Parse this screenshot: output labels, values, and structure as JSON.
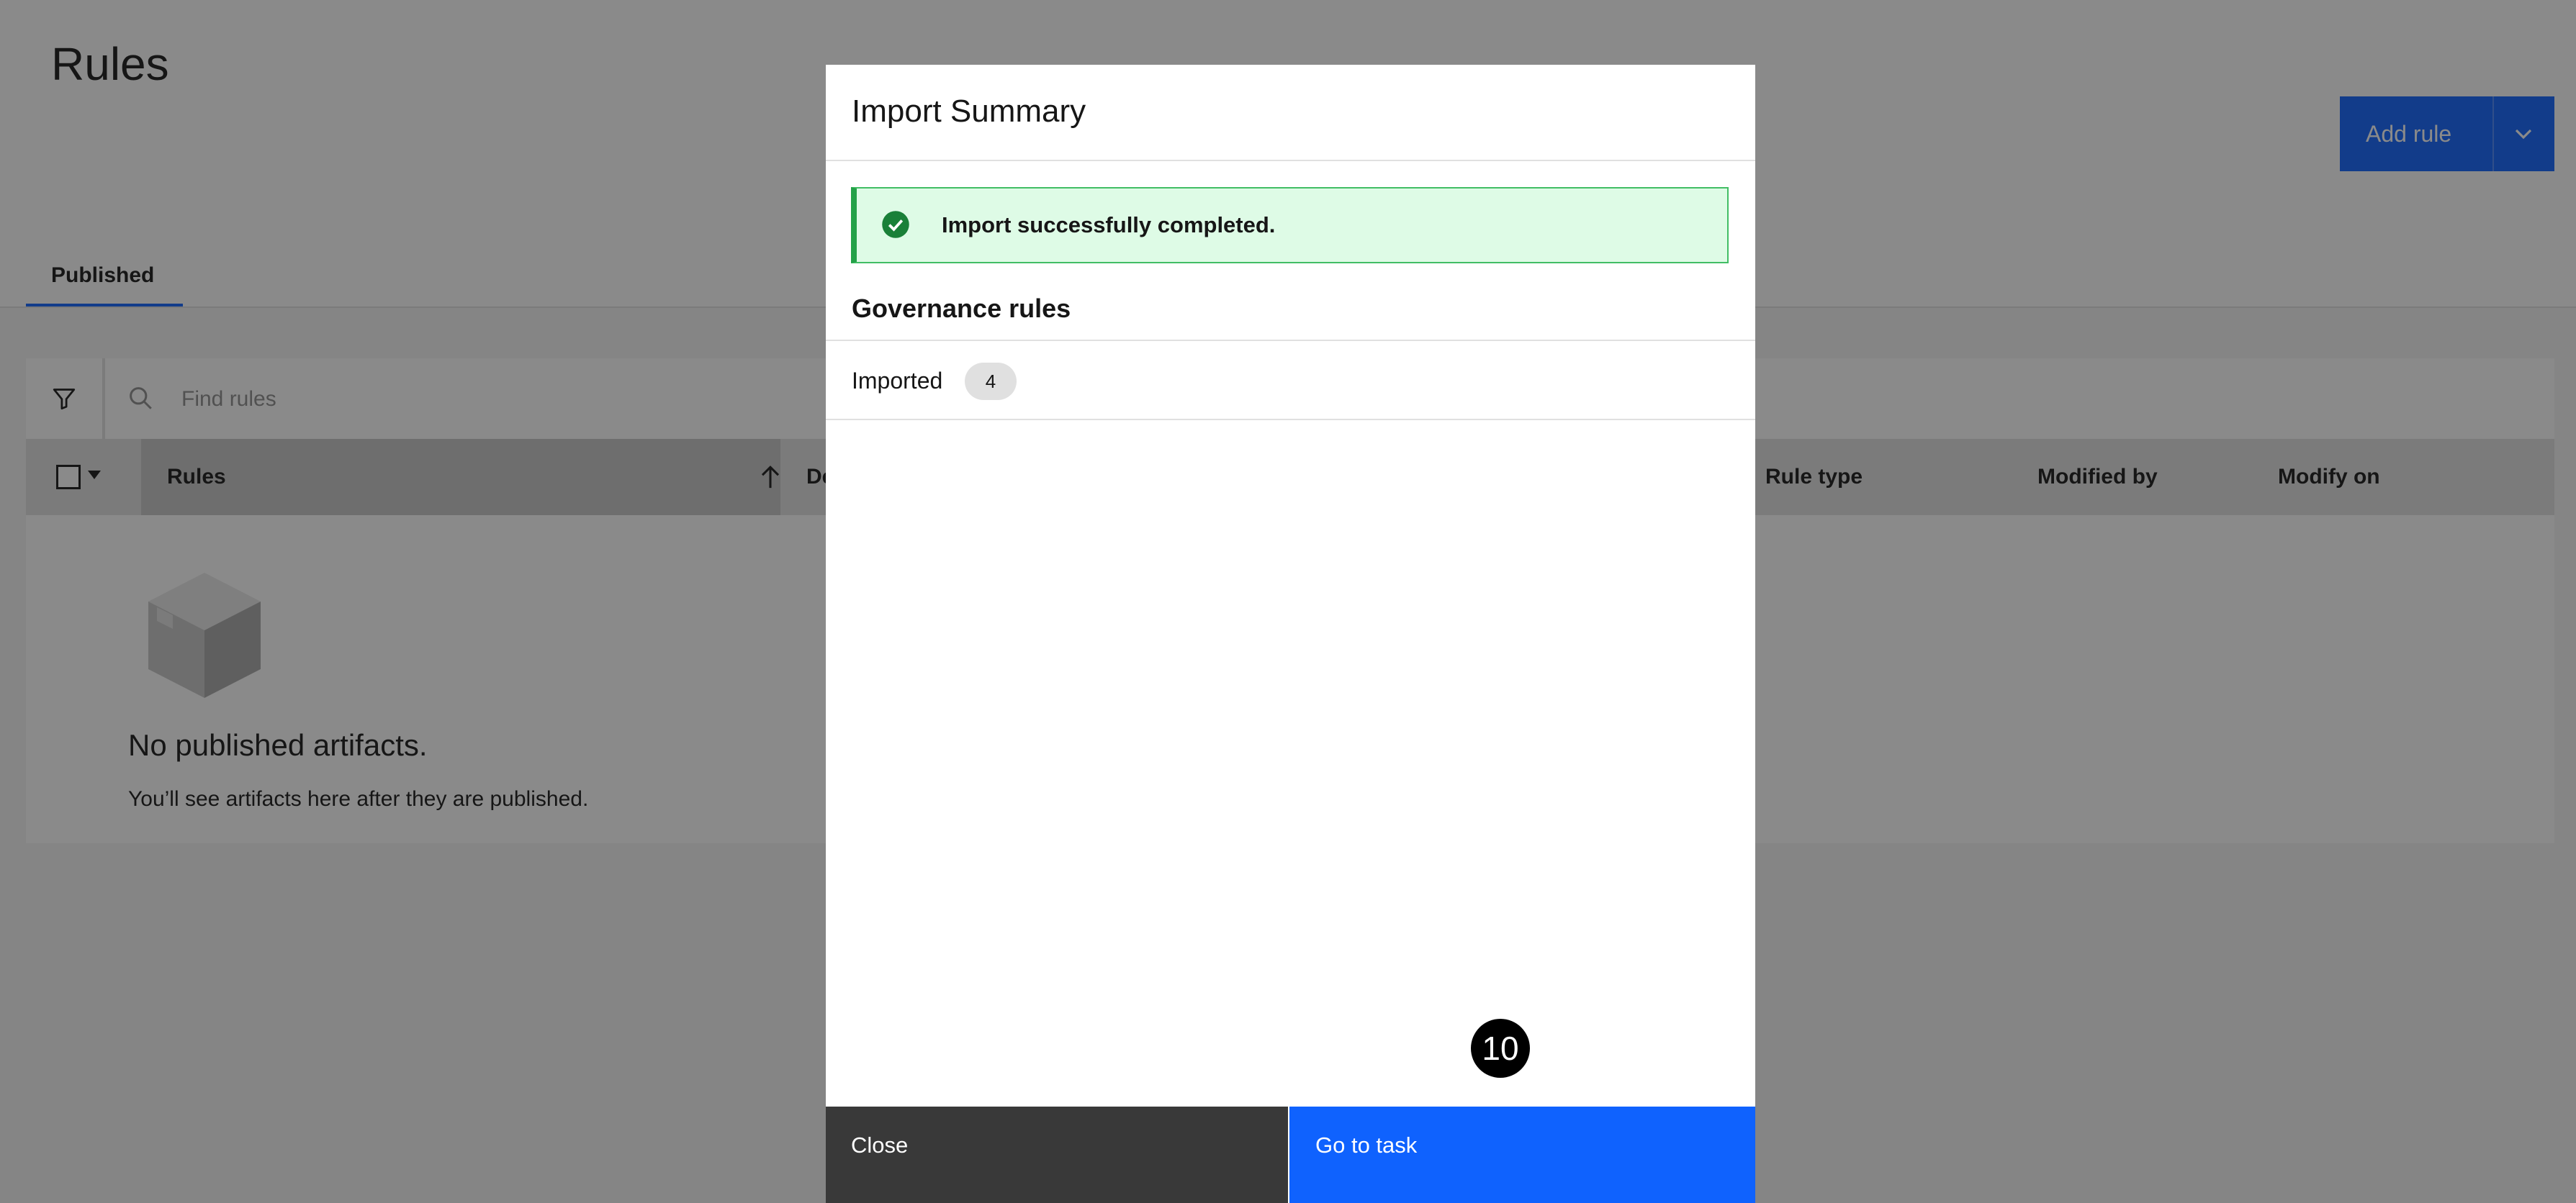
{
  "page": {
    "title": "Rules",
    "add_rule_label": "Add rule",
    "tabs": [
      {
        "label": "Published",
        "selected": true
      }
    ],
    "search": {
      "placeholder": "Find rules"
    },
    "table": {
      "columns": [
        "Rules",
        "De",
        "Rule type",
        "Modified by",
        "Modify on"
      ],
      "sort": {
        "column": "Rules",
        "direction": "ascending"
      }
    },
    "empty_state": {
      "title": "No published artifacts.",
      "subtitle": "You’ll see artifacts here after they are published."
    }
  },
  "modal": {
    "title": "Import Summary",
    "notification": {
      "kind": "success",
      "text": "Import successfully completed."
    },
    "section_title": "Governance rules",
    "rows": [
      {
        "label": "Imported",
        "count": "4"
      }
    ],
    "buttons": {
      "close": "Close",
      "go_to_task": "Go to task"
    }
  },
  "annotation": {
    "step_badge": "10"
  },
  "colors": {
    "primary": "#0f62fe",
    "success_bg": "#defbe6",
    "success_accent": "#24a148",
    "secondary_button": "#393939",
    "overlay": "rgba(22,22,22,0.5)"
  },
  "icons": {
    "filter": "filter-icon",
    "search": "search-icon",
    "sort": "arrow-up-icon",
    "empty": "box-icon",
    "success": "checkmark-filled-icon",
    "dropdown": "chevron-down-icon"
  }
}
